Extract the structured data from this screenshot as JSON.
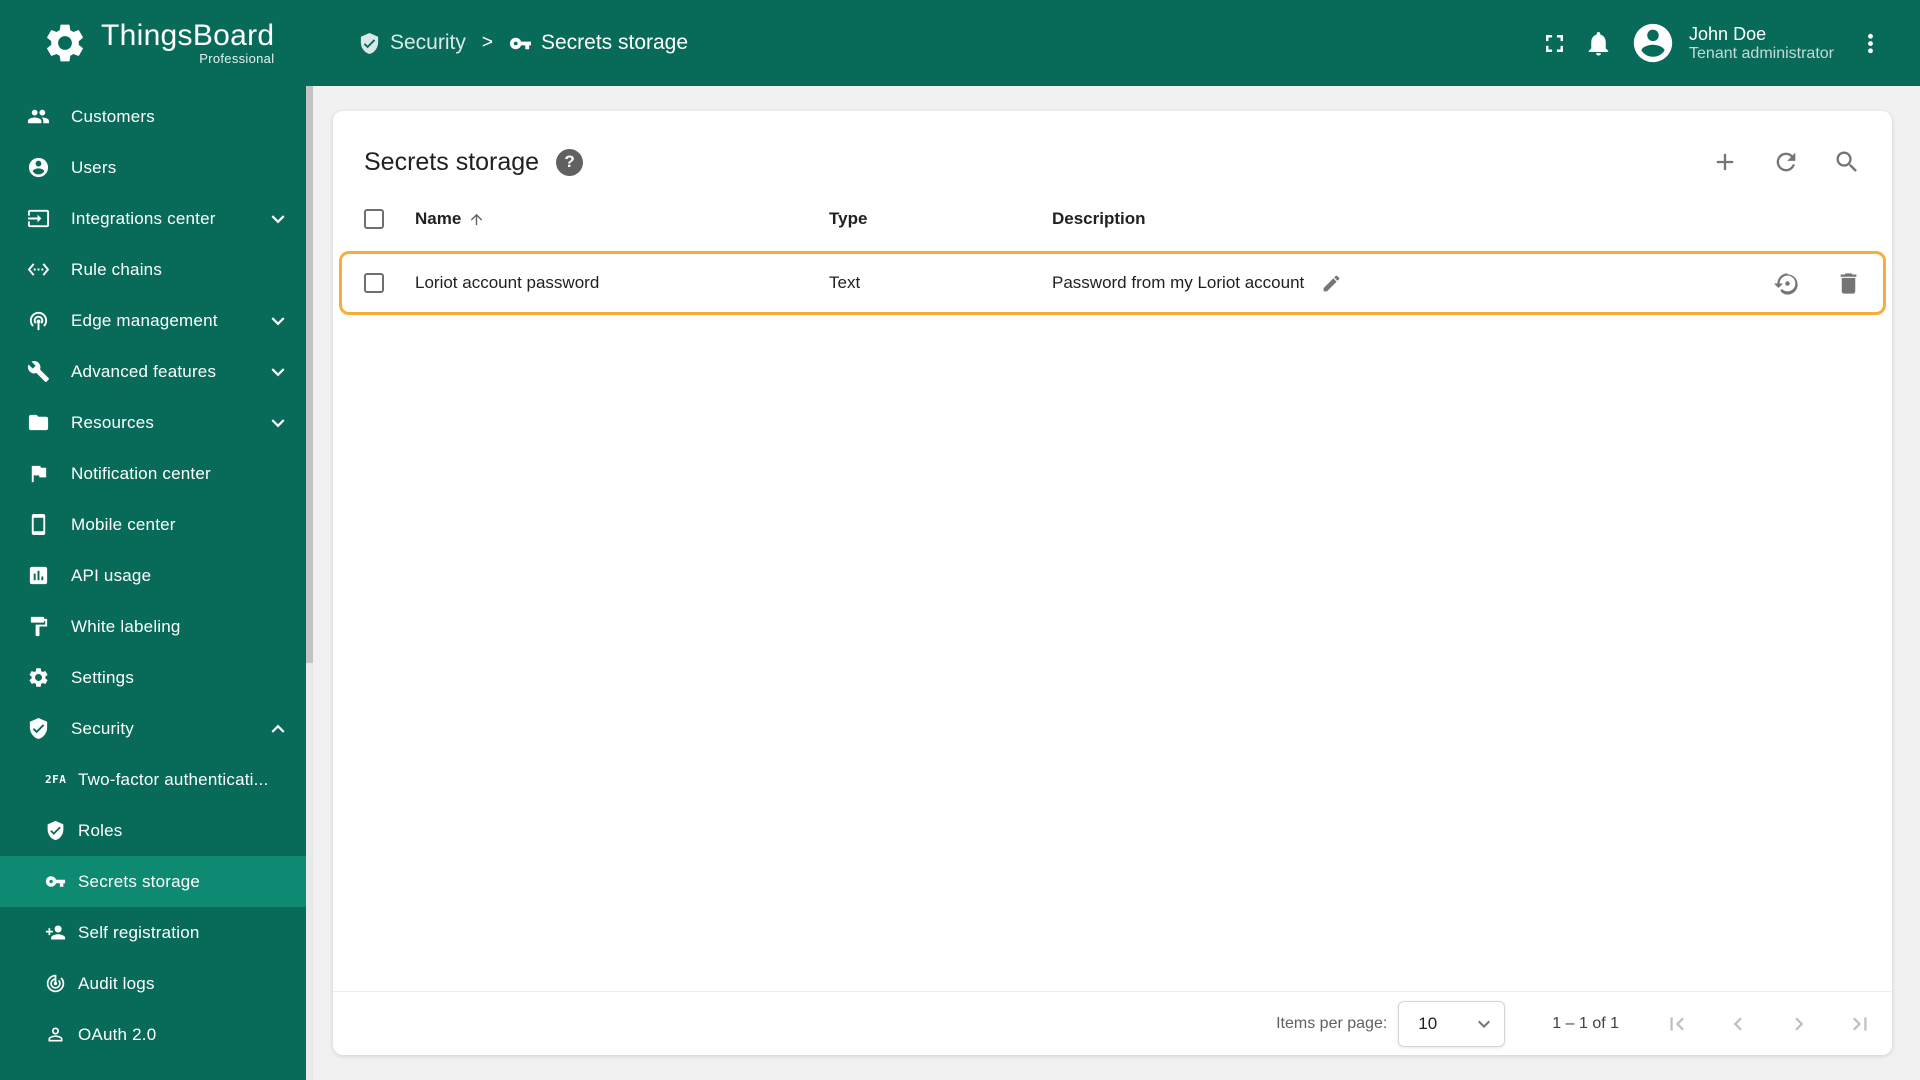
{
  "colors": {
    "brand": "#086b59",
    "brand-selected": "#0d8a71",
    "row-highlight": "#f7ac3b",
    "page-bg": "#f1f1f1",
    "text-dark": "#212121",
    "icon-gray": "#757575",
    "disabled-gray": "#bdbdbd"
  },
  "logo": {
    "title": "ThingsBoard",
    "subtitle": "Professional"
  },
  "header": {
    "breadcrumb": {
      "parent": "Security",
      "separator": ">",
      "current": "Secrets storage"
    },
    "user": {
      "name": "John Doe",
      "role": "Tenant administrator"
    }
  },
  "sidebar": {
    "items": [
      {
        "label": "Customers",
        "icon": "customers-icon"
      },
      {
        "label": "Users",
        "icon": "users-icon"
      },
      {
        "label": "Integrations center",
        "icon": "integrations-icon",
        "expandable": true
      },
      {
        "label": "Rule chains",
        "icon": "rule-chains-icon"
      },
      {
        "label": "Edge management",
        "icon": "edge-management-icon",
        "expandable": true
      },
      {
        "label": "Advanced features",
        "icon": "advanced-features-icon",
        "expandable": true
      },
      {
        "label": "Resources",
        "icon": "resources-icon",
        "expandable": true
      },
      {
        "label": "Notification center",
        "icon": "notification-center-icon"
      },
      {
        "label": "Mobile center",
        "icon": "mobile-center-icon"
      },
      {
        "label": "API usage",
        "icon": "api-usage-icon"
      },
      {
        "label": "White labeling",
        "icon": "white-labeling-icon"
      },
      {
        "label": "Settings",
        "icon": "settings-icon"
      },
      {
        "label": "Security",
        "icon": "security-icon",
        "expandable": true,
        "expanded": true
      }
    ],
    "security_children": [
      {
        "label": "Two-factor authenticati...",
        "icon": "two-factor-icon",
        "icon_text": "2FA"
      },
      {
        "label": "Roles",
        "icon": "roles-icon"
      },
      {
        "label": "Secrets storage",
        "icon": "key-icon",
        "selected": true
      },
      {
        "label": "Self registration",
        "icon": "self-registration-icon"
      },
      {
        "label": "Audit logs",
        "icon": "audit-logs-icon"
      },
      {
        "label": "OAuth 2.0",
        "icon": "oauth-icon"
      }
    ]
  },
  "main": {
    "title": "Secrets storage",
    "help_glyph": "?",
    "table": {
      "columns": {
        "name": "Name",
        "type": "Type",
        "description": "Description"
      },
      "rows": [
        {
          "name": "Loriot account password",
          "type": "Text",
          "description": "Password from my Loriot account"
        }
      ]
    },
    "paginator": {
      "items_per_page_label": "Items per page:",
      "page_size": "10",
      "range_label": "1 – 1 of 1"
    }
  }
}
